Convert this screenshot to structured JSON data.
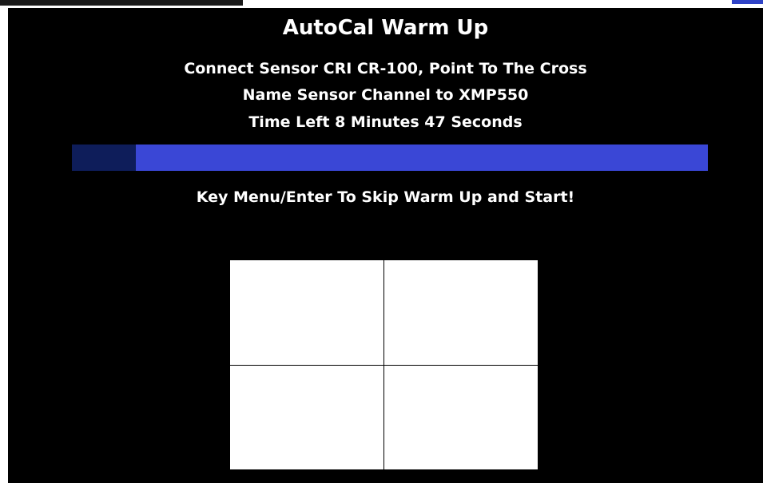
{
  "screen": {
    "title": "AutoCal Warm Up",
    "instruction_lines": [
      "Connect Sensor CRI CR-100, Point To The Cross",
      "Name Sensor Channel to XMP550",
      "Time Left 8 Minutes 47 Seconds"
    ],
    "progress_fraction": 0.1,
    "prompt": "Key Menu/Enter To Skip Warm Up and Start!"
  },
  "colors": {
    "background": "#000000",
    "text": "#ffffff",
    "progress_track": "#3a47d6",
    "progress_fill": "#0e1d5a",
    "target_fill": "#ffffff",
    "cross_line": "#000000"
  },
  "icons": {
    "target": "crosshair-target"
  }
}
